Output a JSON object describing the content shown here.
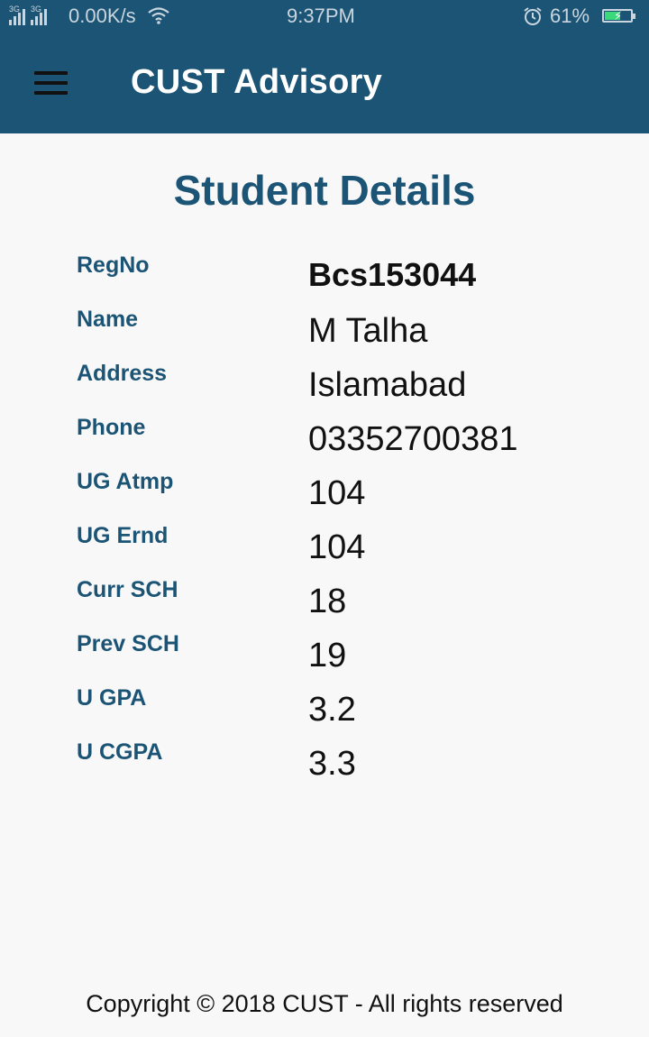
{
  "status_bar": {
    "signal_1_tag": "3G",
    "signal_2_tag": "3G",
    "network_speed": "0.00K/s",
    "wifi_icon": "wifi-icon",
    "time": "9:37PM",
    "alarm_icon": "alarm-icon",
    "battery_percent": "61%",
    "battery_level": 0.61,
    "battery_color": "#3cd97a"
  },
  "app_bar": {
    "menu_icon": "hamburger-menu-icon",
    "title": "CUST Advisory",
    "background_color": "#1c5475"
  },
  "page": {
    "title": "Student Details"
  },
  "details": [
    {
      "label": "RegNo",
      "value": "Bcs153044"
    },
    {
      "label": "Name",
      "value": "M Talha"
    },
    {
      "label": "Address",
      "value": "Islamabad"
    },
    {
      "label": "Phone",
      "value": "03352700381"
    },
    {
      "label": "UG Atmp",
      "value": "104"
    },
    {
      "label": "UG Ernd",
      "value": "104"
    },
    {
      "label": "Curr SCH",
      "value": "18"
    },
    {
      "label": "Prev SCH",
      "value": "19"
    },
    {
      "label": "U GPA",
      "value": "3.2"
    },
    {
      "label": "U CGPA",
      "value": "3.3"
    }
  ],
  "footer": {
    "text": "Copyright © 2018 CUST - All rights reserved"
  }
}
